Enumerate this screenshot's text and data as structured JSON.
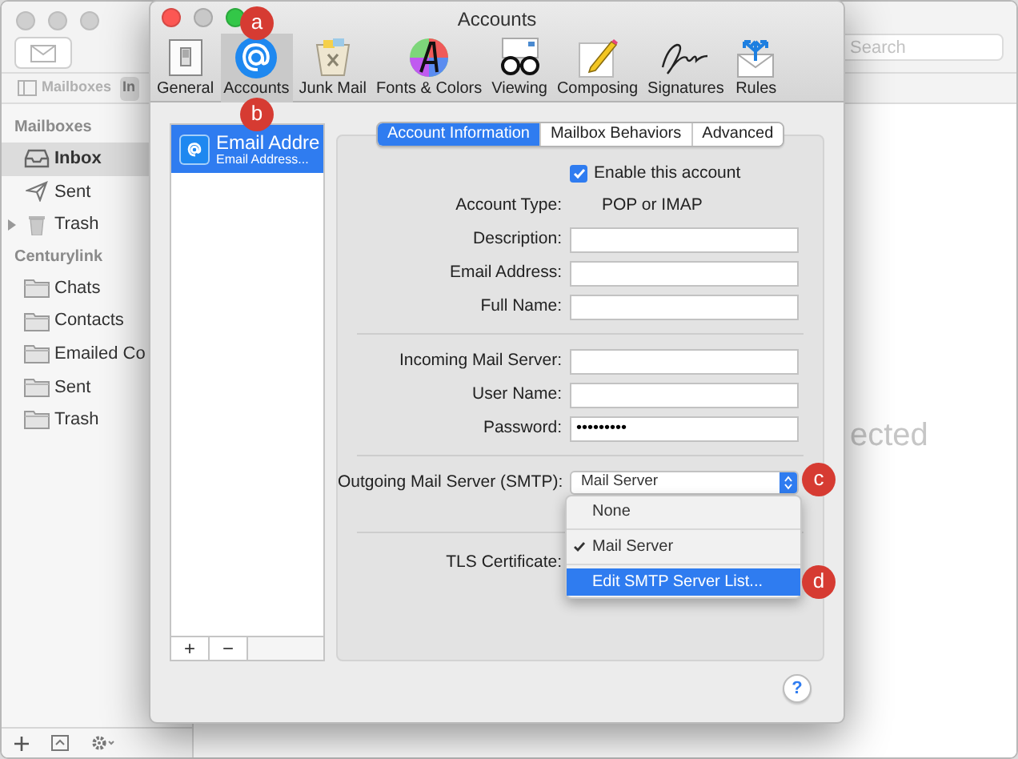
{
  "mail_window": {
    "search": {
      "placeholder": "Search"
    },
    "favorites": [
      {
        "label": "Mailboxes",
        "kind": "mailboxes",
        "selected": false
      },
      {
        "label": "In",
        "kind": "tab",
        "selected": true
      }
    ],
    "sidebar": [
      {
        "header": "Mailboxes",
        "items": [
          {
            "label": "Inbox",
            "kind": "inbox",
            "selected": true,
            "expandable": false
          },
          {
            "label": "Sent",
            "kind": "sent",
            "selected": false,
            "expandable": false
          },
          {
            "label": "Trash",
            "kind": "trash",
            "selected": false,
            "expandable": true
          }
        ]
      },
      {
        "header": "Centurylink",
        "items": [
          {
            "label": "Chats",
            "kind": "folder",
            "selected": false,
            "expandable": false
          },
          {
            "label": "Contacts",
            "kind": "folder",
            "selected": false,
            "expandable": false
          },
          {
            "label": "Emailed Co",
            "kind": "folder",
            "selected": false,
            "expandable": false
          },
          {
            "label": "Sent",
            "kind": "folder",
            "selected": false,
            "expandable": false
          },
          {
            "label": "Trash",
            "kind": "folder",
            "selected": false,
            "expandable": false
          }
        ]
      }
    ],
    "content_text": "ected"
  },
  "dialog": {
    "title": "Accounts",
    "toolbar": [
      {
        "label": "General",
        "kind": "general",
        "selected": false
      },
      {
        "label": "Accounts",
        "kind": "accounts",
        "selected": true
      },
      {
        "label": "Junk Mail",
        "kind": "junk",
        "selected": false
      },
      {
        "label": "Fonts & Colors",
        "kind": "fonts",
        "selected": false
      },
      {
        "label": "Viewing",
        "kind": "viewing",
        "selected": false
      },
      {
        "label": "Composing",
        "kind": "composing",
        "selected": false
      },
      {
        "label": "Signatures",
        "kind": "signatures",
        "selected": false
      },
      {
        "label": "Rules",
        "kind": "rules",
        "selected": false
      }
    ],
    "accounts": [
      {
        "title": "Email Addre",
        "subtitle": "Email Address...",
        "selected": true
      }
    ],
    "list_buttons": [
      "+",
      "−"
    ],
    "tabs": [
      {
        "label": "Account Information",
        "selected": true
      },
      {
        "label": "Mailbox Behaviors",
        "selected": false
      },
      {
        "label": "Advanced",
        "selected": false
      }
    ],
    "enable": {
      "label": "Enable this account",
      "checked": true
    },
    "sections": [
      {
        "rows": [
          {
            "label": "Account Type:",
            "kind": "static",
            "value": "POP or IMAP"
          },
          {
            "label": "Description:",
            "kind": "text"
          },
          {
            "label": "Email Address:",
            "kind": "text"
          },
          {
            "label": "Full Name:",
            "kind": "text"
          }
        ]
      },
      {
        "rows": [
          {
            "label": "Incoming Mail Server:",
            "kind": "text"
          },
          {
            "label": "User Name:",
            "kind": "text"
          },
          {
            "label": "Password:",
            "kind": "password",
            "value": "•••••••••"
          }
        ]
      },
      {
        "rows": [
          {
            "label": "Outgoing Mail Server (SMTP):",
            "kind": "popup",
            "value": "Mail Server"
          }
        ]
      },
      {
        "rows": [
          {
            "label": "TLS Certificate:",
            "kind": "hidden"
          }
        ]
      }
    ],
    "menu": {
      "items": [
        {
          "label": "None",
          "checked": false,
          "selected": false
        },
        {
          "label": "Mail Server",
          "checked": true,
          "selected": false
        },
        {
          "label": "Edit SMTP Server List...",
          "checked": false,
          "selected": true
        }
      ]
    },
    "callouts": [
      "a",
      "b",
      "c",
      "d"
    ],
    "help": "?"
  }
}
